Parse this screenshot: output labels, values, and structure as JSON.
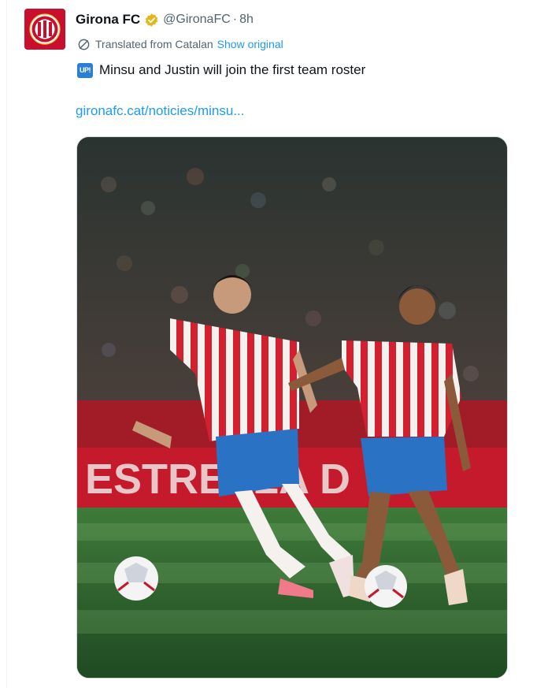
{
  "tweet": {
    "display_name": "Girona FC",
    "handle": "@GironaFC",
    "separator": "·",
    "time": "8h",
    "translated_label": "Translated from Catalan",
    "show_original_label": "Show original",
    "badge_text": "UP!",
    "text": "Minsu and Justin will join the first team roster",
    "link_text": "gironafc.cat/noticies/minsu..."
  },
  "icons": {
    "avatar": "girona-fc-crest",
    "verified": "gold-verified-badge",
    "translate": "translate-icon",
    "badge": "up-emoji"
  },
  "colors": {
    "accent": "#1d9bf0",
    "secondary_text": "#536471",
    "verified_gold": "#e2b719",
    "brand_red": "#c8102e"
  }
}
